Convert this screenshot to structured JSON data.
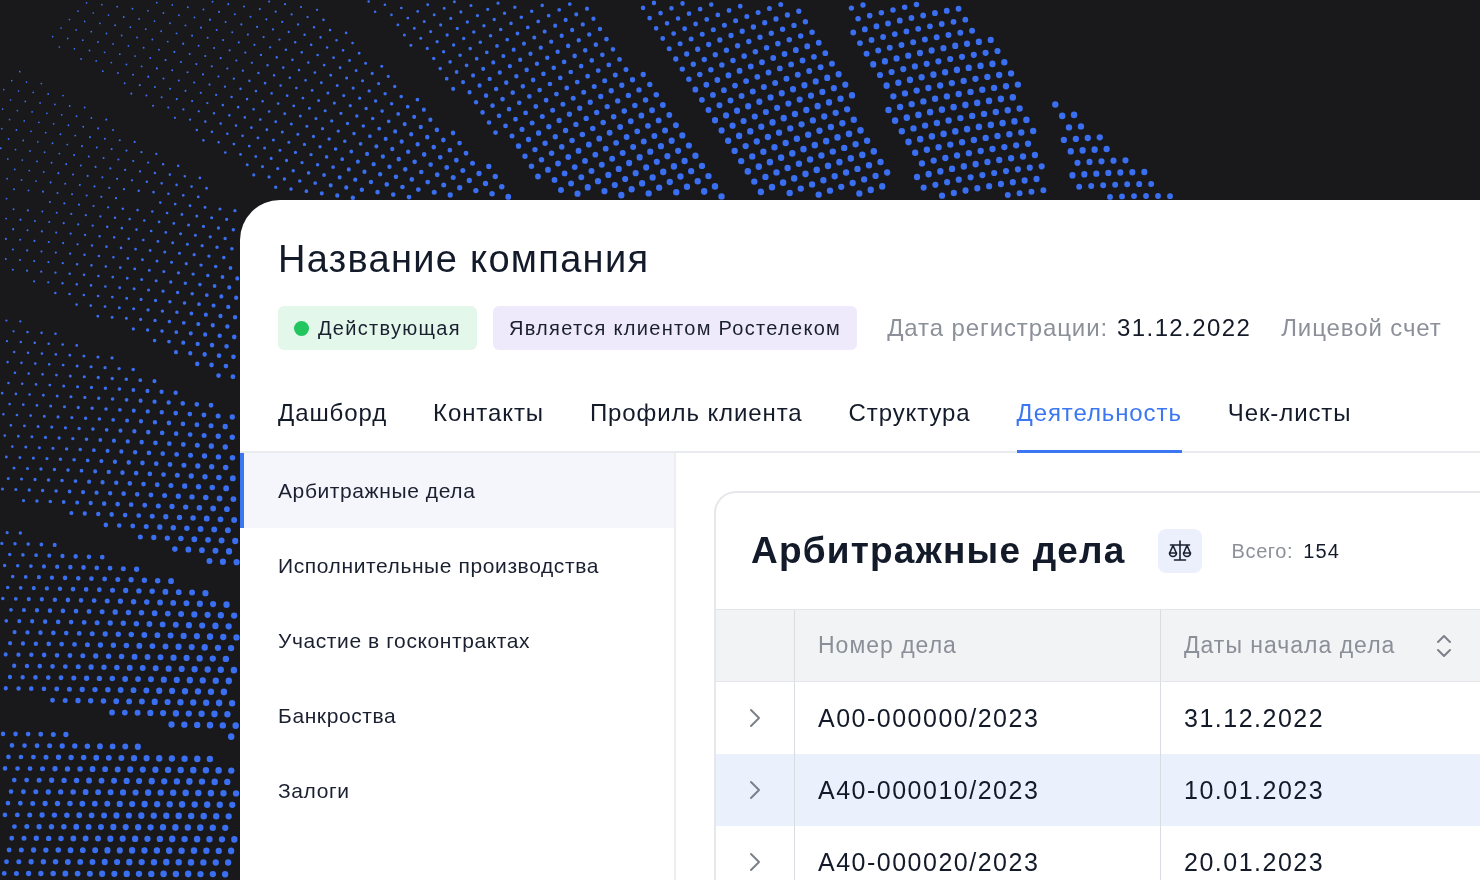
{
  "company": {
    "title": "Название компания",
    "tags": [
      {
        "kind": "status",
        "label": "Действующая",
        "color": "#22c55e"
      },
      {
        "kind": "client",
        "label": "Является клиентом Ростелеком"
      }
    ],
    "meta": [
      {
        "label": "Дата регистрации:",
        "value": "31.12.2022"
      },
      {
        "label": "Лицевой счет"
      }
    ]
  },
  "tabs": [
    {
      "label": "Дашборд",
      "selected": false
    },
    {
      "label": "Контакты",
      "selected": false
    },
    {
      "label": "Профиль клиента",
      "selected": false
    },
    {
      "label": "Структура",
      "selected": false
    },
    {
      "label": "Деятельность",
      "selected": true
    },
    {
      "label": "Чек-листы",
      "selected": false
    }
  ],
  "sidebar": {
    "items": [
      {
        "label": "Арбитражные дела",
        "selected": true
      },
      {
        "label": "Исполнительные производства",
        "selected": false
      },
      {
        "label": "Участие в госконтрактах",
        "selected": false
      },
      {
        "label": "Банкроства",
        "selected": false
      },
      {
        "label": "Залоги",
        "selected": false
      }
    ]
  },
  "cases": {
    "title": "Арбитражные дела",
    "total_label": "Всего:",
    "total": "154",
    "table": {
      "columns": [
        {
          "label": "Номер дела",
          "sortable": false
        },
        {
          "label": "Даты начала дела",
          "sortable": true
        }
      ],
      "rows": [
        {
          "number": "A00-000000/2023",
          "date": "31.12.2022",
          "selected": false,
          "expanded": false
        },
        {
          "number": "A40-000010/2023",
          "date": "10.01.2023",
          "selected": true,
          "expanded": false
        },
        {
          "number": "A40-000020/2023",
          "date": "20.01.2023",
          "selected": false,
          "expanded": false
        }
      ]
    }
  }
}
